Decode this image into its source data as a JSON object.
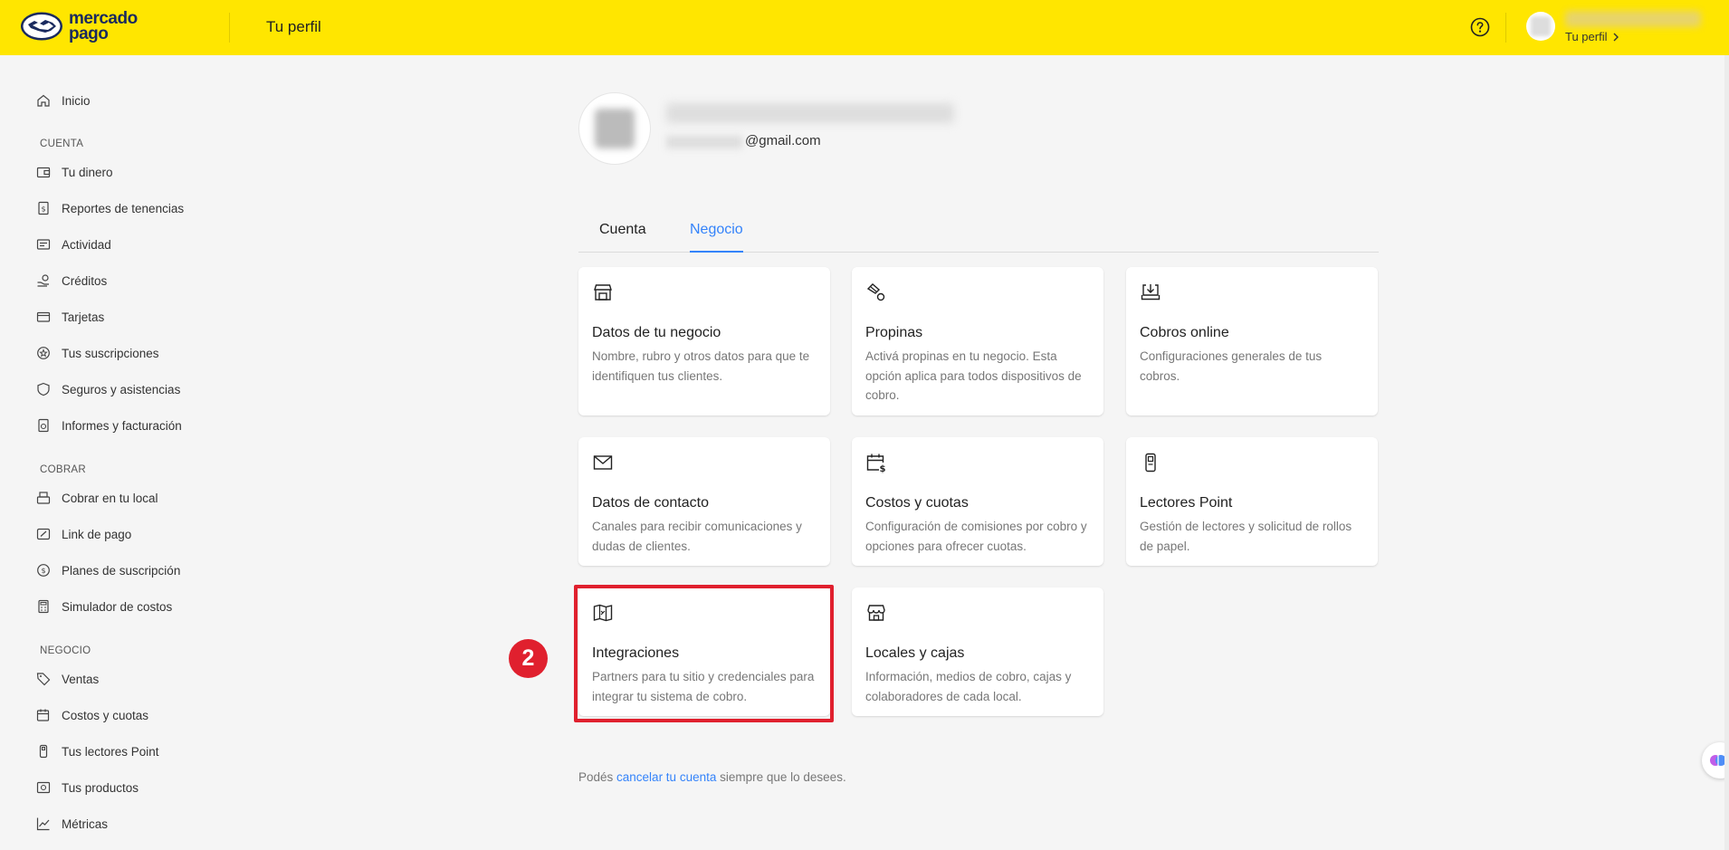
{
  "header": {
    "logo_line1": "mercado",
    "logo_line2": "pago",
    "title": "Tu perfil",
    "profile_link": "Tu perfil"
  },
  "sidebar": {
    "home": "Inicio",
    "sections": [
      {
        "title": "CUENTA",
        "items": [
          "Tu dinero",
          "Reportes de tenencias",
          "Actividad",
          "Créditos",
          "Tarjetas",
          "Tus suscripciones",
          "Seguros y asistencias",
          "Informes y facturación"
        ]
      },
      {
        "title": "COBRAR",
        "items": [
          "Cobrar en tu local",
          "Link de pago",
          "Planes de suscripción",
          "Simulador de costos"
        ]
      },
      {
        "title": "NEGOCIO",
        "items": [
          "Ventas",
          "Costos y cuotas",
          "Tus lectores Point",
          "Tus productos",
          "Métricas"
        ]
      }
    ]
  },
  "profile": {
    "email_suffix": "@gmail.com"
  },
  "tabs": {
    "cuenta": "Cuenta",
    "negocio": "Negocio",
    "active": "Negocio"
  },
  "cards": [
    {
      "icon": "store-icon",
      "title": "Datos de tu negocio",
      "desc": "Nombre, rubro y otros datos para que te identifiquen tus clientes."
    },
    {
      "icon": "tip-icon",
      "title": "Propinas",
      "desc": "Activá propinas en tu negocio. Esta opción aplica para todos dispositivos de cobro."
    },
    {
      "icon": "download-icon",
      "title": "Cobros online",
      "desc": "Configuraciones generales de tus cobros."
    },
    {
      "icon": "envelope-icon",
      "title": "Datos de contacto",
      "desc": "Canales para recibir comunicaciones y dudas de clientes."
    },
    {
      "icon": "calendar-money-icon",
      "title": "Costos y cuotas",
      "desc": "Configuración de comisiones por cobro y opciones para ofrecer cuotas."
    },
    {
      "icon": "card-reader-icon",
      "title": "Lectores Point",
      "desc": "Gestión de lectores y solicitud de rollos de papel."
    },
    {
      "icon": "integration-map-icon",
      "title": "Integraciones",
      "desc": "Partners para tu sitio y credenciales para integrar tu sistema de cobro."
    },
    {
      "icon": "shop-front-icon",
      "title": "Locales y cajas",
      "desc": "Información, medios de cobro, cajas y colaboradores de cada local."
    }
  ],
  "annotation": {
    "badge": "2"
  },
  "footer": {
    "prefix": "Podés ",
    "link": "cancelar tu cuenta",
    "suffix": " siempre que lo desees."
  },
  "colors": {
    "brand_yellow": "#ffe600",
    "link_blue": "#3483fa",
    "highlight_red": "#e0202e"
  }
}
